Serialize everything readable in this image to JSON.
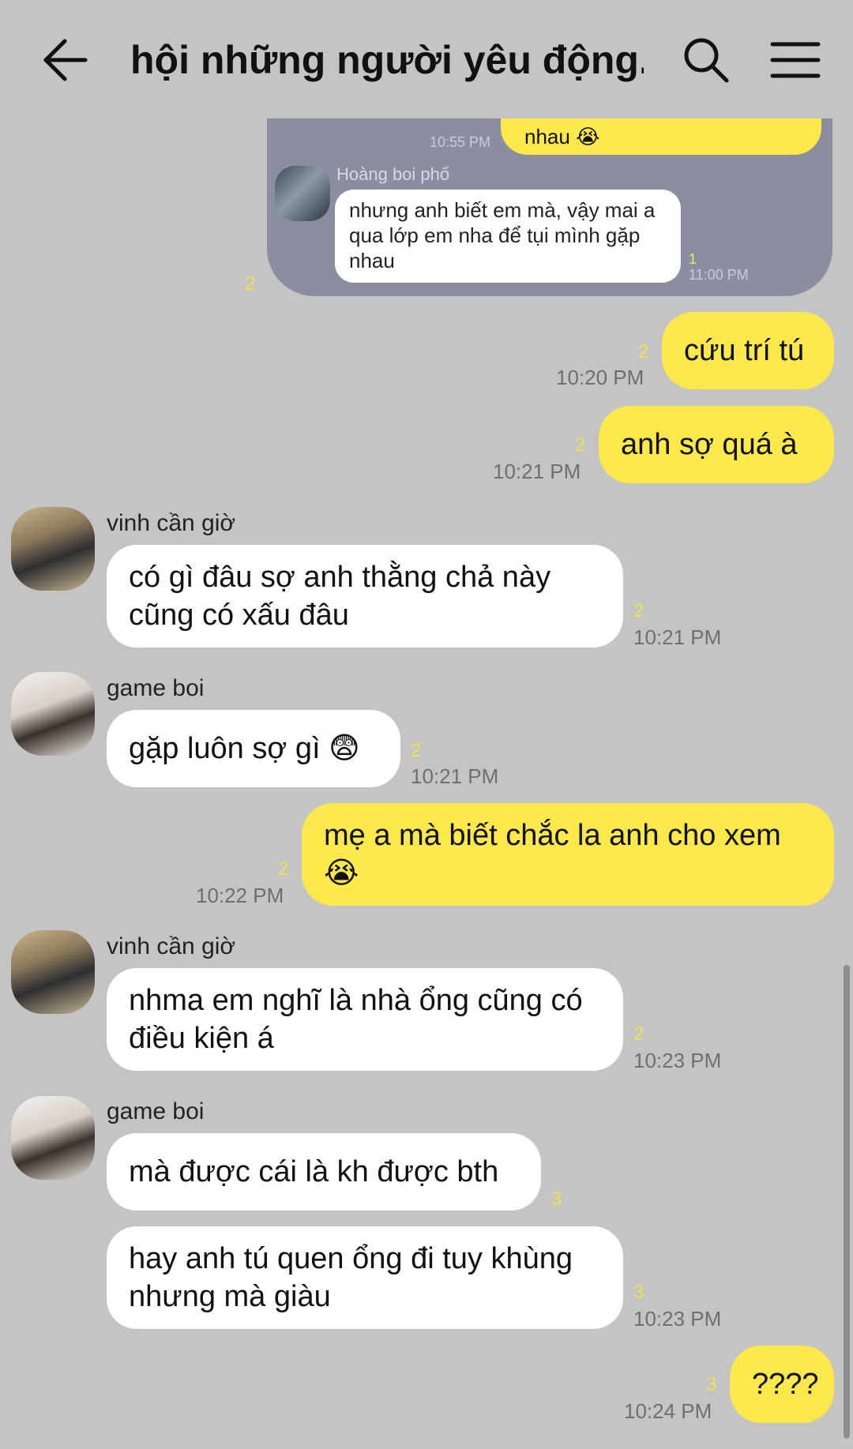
{
  "header": {
    "title": "hội những người yêu động...",
    "back_icon": "arrow-left-icon",
    "search_icon": "search-icon",
    "menu_icon": "hamburger-menu-icon"
  },
  "quoted": {
    "prev_text": "nhau 😭",
    "prev_time": "10:55 PM",
    "sender": "Hoàng boi phố",
    "text": "nhưng anh biết em mà, vậy mai a qua lớp em nha để tụi mình gặp nhau",
    "unread": "1",
    "time": "11:00 PM",
    "outer_unread": "2"
  },
  "messages": [
    {
      "dir": "out",
      "text": "cứu trí tú",
      "unread": "2",
      "time": "10:20 PM"
    },
    {
      "dir": "out",
      "text": "anh sợ quá à",
      "unread": "2",
      "time": "10:21 PM"
    },
    {
      "dir": "in",
      "sender": "vinh cần giờ",
      "text": "có gì đâu sợ anh thằng chả này cũng có xấu đâu",
      "unread": "2",
      "time": "10:21 PM"
    },
    {
      "dir": "in",
      "sender": "game boi",
      "text": "gặp luôn sợ gì 😨",
      "unread": "2",
      "time": "10:21 PM"
    },
    {
      "dir": "out",
      "text": "mẹ a mà biết chắc la anh cho xem 😭",
      "unread": "2",
      "time": "10:22 PM"
    },
    {
      "dir": "in",
      "sender": "vinh cần giờ",
      "text": "nhma em nghĩ là nhà ổng cũng có điều kiện á",
      "unread": "2",
      "time": "10:23 PM"
    },
    {
      "dir": "in",
      "sender": "game boi",
      "text": "mà được cái là kh được bth",
      "unread": "3",
      "time": ""
    },
    {
      "dir": "in",
      "text": "hay anh tú quen ổng đi tuy khùng nhưng mà giàu",
      "unread": "3",
      "time": "10:23 PM"
    },
    {
      "dir": "out",
      "text": "????",
      "unread": "3",
      "time": "10:24 PM"
    }
  ]
}
